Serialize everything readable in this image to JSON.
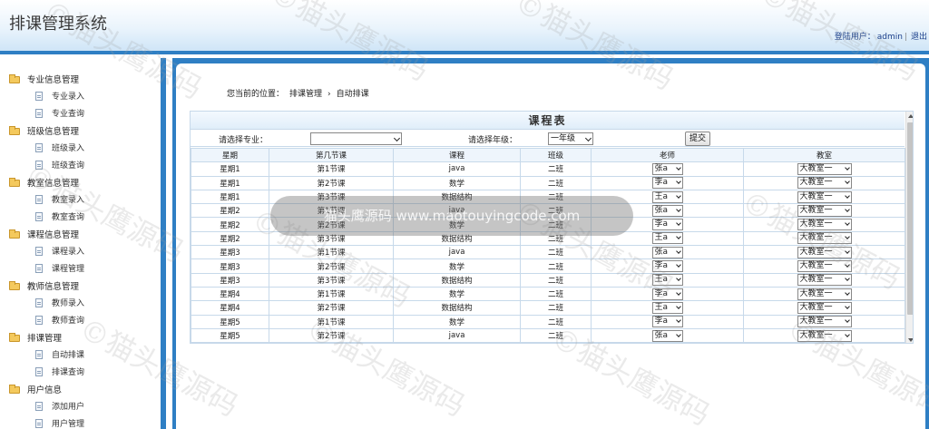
{
  "app": {
    "title": "排课管理系统"
  },
  "header": {
    "user_label": "登陆用户：",
    "username": "admin",
    "separator": "|",
    "logout": "退出"
  },
  "sidebar": {
    "groups": [
      {
        "title": "专业信息管理",
        "items": [
          "专业录入",
          "专业查询"
        ]
      },
      {
        "title": "班级信息管理",
        "items": [
          "班级录入",
          "班级查询"
        ]
      },
      {
        "title": "教室信息管理",
        "items": [
          "教室录入",
          "教室查询"
        ]
      },
      {
        "title": "课程信息管理",
        "items": [
          "课程录入",
          "课程管理"
        ]
      },
      {
        "title": "教师信息管理",
        "items": [
          "教师录入",
          "教师查询"
        ]
      },
      {
        "title": "排课管理",
        "items": [
          "自动排课",
          "排课查询"
        ]
      },
      {
        "title": "用户信息",
        "items": [
          "添加用户",
          "用户管理"
        ]
      }
    ],
    "icons": {
      "group": "folder-icon",
      "item": "document-icon"
    }
  },
  "breadcrumb": {
    "prefix": "您当前的位置：",
    "level1": "排课管理",
    "arrow": "›",
    "level2": "自动排课"
  },
  "schedule": {
    "title": "课程表",
    "filter": {
      "major_label": "请选择专业：",
      "major_value": "",
      "grade_label": "请选择年级：",
      "grade_value": "一年级",
      "submit": "提交"
    },
    "columns": [
      "星期",
      "第几节课",
      "课程",
      "班级",
      "老师",
      "教室"
    ],
    "rows": [
      {
        "day": "星期1",
        "period": "第1节课",
        "course": "java",
        "class": "二班",
        "teacher": "张a",
        "room": "大教室一"
      },
      {
        "day": "星期1",
        "period": "第2节课",
        "course": "数学",
        "class": "二班",
        "teacher": "李a",
        "room": "大教室一"
      },
      {
        "day": "星期1",
        "period": "第3节课",
        "course": "数据结构",
        "class": "二班",
        "teacher": "王a",
        "room": "大教室一"
      },
      {
        "day": "星期2",
        "period": "第1节课",
        "course": "java",
        "class": "二班",
        "teacher": "张a",
        "room": "大教室一"
      },
      {
        "day": "星期2",
        "period": "第2节课",
        "course": "数学",
        "class": "二班",
        "teacher": "李a",
        "room": "大教室一"
      },
      {
        "day": "星期2",
        "period": "第3节课",
        "course": "数据结构",
        "class": "二班",
        "teacher": "王a",
        "room": "大教室一"
      },
      {
        "day": "星期3",
        "period": "第1节课",
        "course": "java",
        "class": "二班",
        "teacher": "张a",
        "room": "大教室一"
      },
      {
        "day": "星期3",
        "period": "第2节课",
        "course": "数学",
        "class": "二班",
        "teacher": "李a",
        "room": "大教室一"
      },
      {
        "day": "星期3",
        "period": "第3节课",
        "course": "数据结构",
        "class": "二班",
        "teacher": "王a",
        "room": "大教室一"
      },
      {
        "day": "星期4",
        "period": "第1节课",
        "course": "数学",
        "class": "二班",
        "teacher": "李a",
        "room": "大教室一"
      },
      {
        "day": "星期4",
        "period": "第2节课",
        "course": "数据结构",
        "class": "二班",
        "teacher": "王a",
        "room": "大教室一"
      },
      {
        "day": "星期5",
        "period": "第1节课",
        "course": "数学",
        "class": "二班",
        "teacher": "李a",
        "room": "大教室一"
      },
      {
        "day": "星期5",
        "period": "第2节课",
        "course": "java",
        "class": "二班",
        "teacher": "张a",
        "room": "大教室一"
      }
    ]
  },
  "watermark": {
    "text": "©猫头鹰源码",
    "banner": "猫头鹰源码 www.maotouyingcode.com"
  },
  "colors": {
    "accent": "#2f7fc4",
    "header_bg": "#eaf4fc",
    "table_border": "#c7d9ea"
  }
}
